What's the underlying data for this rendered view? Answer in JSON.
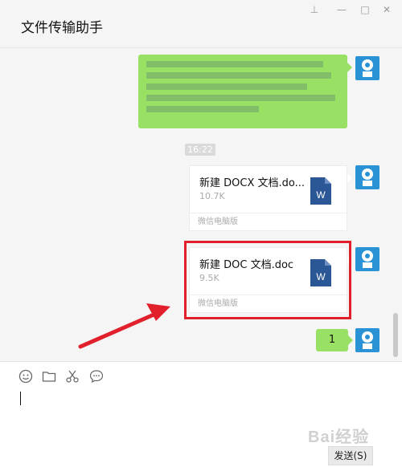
{
  "window": {
    "title": "文件传输助手",
    "controls": [
      "pin-icon",
      "minimize-icon",
      "maximize-icon",
      "close-icon"
    ]
  },
  "chat": {
    "timestamp": "16:22",
    "files": [
      {
        "name": "新建 DOCX 文档.do...",
        "size": "10.7K",
        "footer": "微信电脑版",
        "icon": "word-doc-icon",
        "icon_letter": "W"
      },
      {
        "name": "新建 DOC 文档.doc",
        "size": "9.5K",
        "footer": "微信电脑版",
        "icon": "word-doc-icon",
        "icon_letter": "W",
        "highlighted": true
      }
    ],
    "text_message": "1"
  },
  "toolbar": {
    "icons": [
      "emoji-icon",
      "folder-icon",
      "scissors-icon",
      "chat-history-icon"
    ]
  },
  "input": {
    "value": ""
  },
  "send_button": {
    "label": "发送(S)"
  },
  "watermark": {
    "text": "Bai经验"
  },
  "colors": {
    "bubble_green": "#98e165",
    "highlight_red": "#e2202b",
    "word_blue": "#2b5797",
    "avatar_blue": "#2a93d6"
  }
}
